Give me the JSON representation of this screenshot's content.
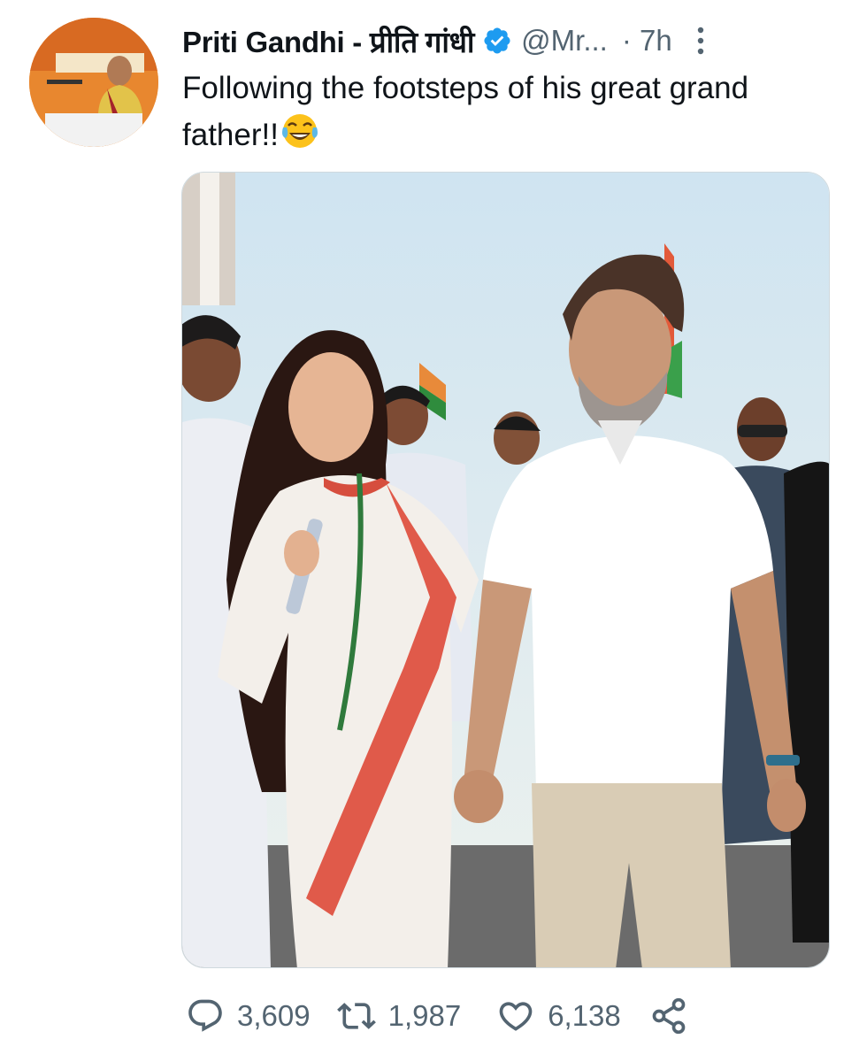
{
  "tweet": {
    "author_name": "Priti Gandhi - प्रीति गांधी",
    "handle": "@Mr...",
    "time": "· 7h",
    "text": "Following the footsteps of his great grand father!!",
    "emoji": "face-with-tears-of-joy"
  },
  "actions": {
    "replies": "3,609",
    "retweets": "1,987",
    "likes": "6,138"
  },
  "colors": {
    "verified": "#1d9bf0",
    "secondary_text": "#536471",
    "avatar_bg": "#e8872f"
  },
  "icons": [
    "verified-badge-icon",
    "more-options-icon",
    "reply-icon",
    "retweet-icon",
    "like-icon",
    "share-icon"
  ]
}
